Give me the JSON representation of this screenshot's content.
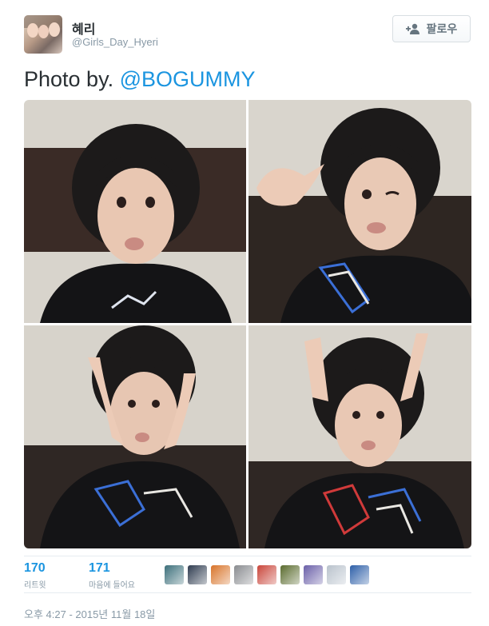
{
  "user": {
    "name": "혜리",
    "handle": "@Girls_Day_Hyeri"
  },
  "follow_button": {
    "label": "팔로우"
  },
  "tweet": {
    "text_prefix": "Photo by.",
    "mention": "@BOGUMMY"
  },
  "stats": {
    "retweets": {
      "count": "170",
      "label": "리트윗"
    },
    "likes": {
      "count": "171",
      "label": "마음에 들어요"
    }
  },
  "likers": [
    {
      "name": "liker-avatar-1",
      "color": "#3c6f7a"
    },
    {
      "name": "liker-avatar-2",
      "color": "#2e3b4f"
    },
    {
      "name": "liker-avatar-3",
      "color": "#d8742a"
    },
    {
      "name": "liker-avatar-4",
      "color": "#8a8c90"
    },
    {
      "name": "liker-avatar-5",
      "color": "#c9453a"
    },
    {
      "name": "liker-avatar-6",
      "color": "#5a6b2e"
    },
    {
      "name": "liker-avatar-7",
      "color": "#6a5fa8"
    },
    {
      "name": "liker-avatar-8",
      "color": "#b9c2cc"
    },
    {
      "name": "liker-avatar-9",
      "color": "#2d5fa8"
    }
  ],
  "timestamp": "오후 4:27 - 2015년 11월 18일",
  "colors": {
    "link": "#1b95e0",
    "muted": "#8899a6",
    "text": "#292f33"
  }
}
